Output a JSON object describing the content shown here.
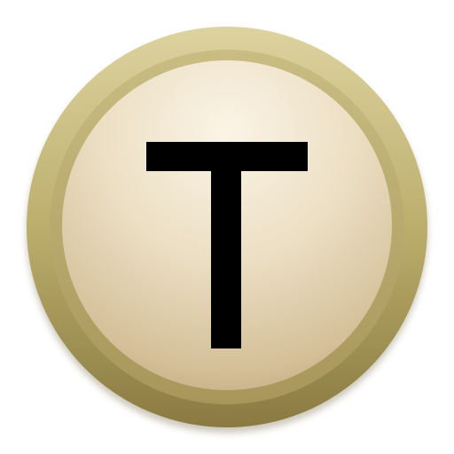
{
  "app_icon": {
    "icon": "letter-t-icon",
    "letter": "T",
    "colors": {
      "outer_ring_light": "#d7cd97",
      "outer_ring_mid": "#bcae6c",
      "outer_ring_dark": "#8f7e44",
      "face_center": "#f7eedb",
      "face_mid": "#e6d7b9",
      "face_edge": "#c2a97f",
      "glyph": "#000000"
    }
  }
}
